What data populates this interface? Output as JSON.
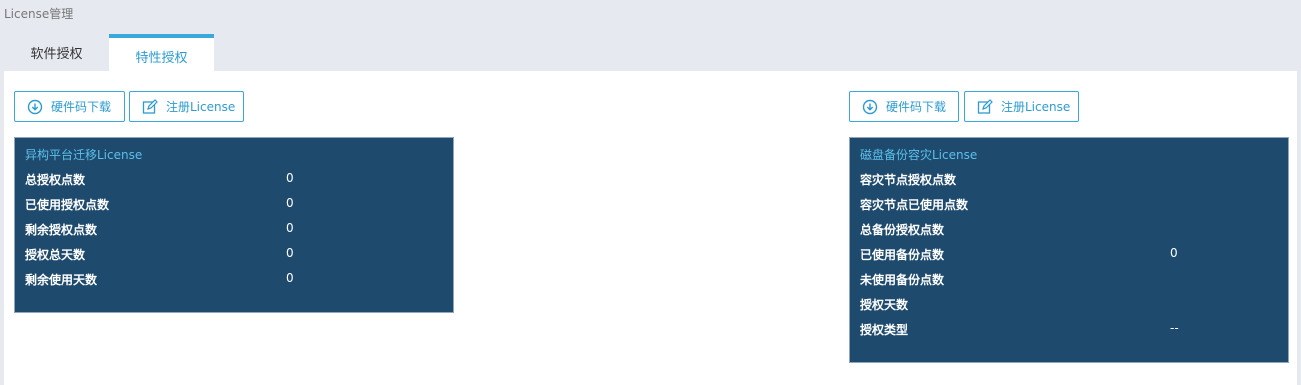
{
  "page_title": "License管理",
  "tabs": [
    {
      "label": "软件授权"
    },
    {
      "label": "特性授权"
    }
  ],
  "buttons": {
    "hw_download": "硬件码下载",
    "register": "注册License"
  },
  "panel_left": {
    "title": "异构平台迁移License",
    "rows": [
      {
        "label": "总授权点数",
        "value": "0"
      },
      {
        "label": "已使用授权点数",
        "value": "0"
      },
      {
        "label": "剩余授权点数",
        "value": "0"
      },
      {
        "label": "授权总天数",
        "value": "0"
      },
      {
        "label": "剩余使用天数",
        "value": "0"
      }
    ]
  },
  "panel_right": {
    "title": "磁盘备份容灾License",
    "rows": [
      {
        "label": "容灾节点授权点数",
        "value": ""
      },
      {
        "label": "容灾节点已使用点数",
        "value": ""
      },
      {
        "label": "总备份授权点数",
        "value": ""
      },
      {
        "label": "已使用备份点数",
        "value": "0"
      },
      {
        "label": "未使用备份点数",
        "value": ""
      },
      {
        "label": "授权天数",
        "value": ""
      },
      {
        "label": "授权类型",
        "value": "--"
      }
    ]
  },
  "colors": {
    "accent": "#3ba8dc",
    "panel_bg": "#1e4a6e",
    "panel_title": "#5cc0ea"
  }
}
